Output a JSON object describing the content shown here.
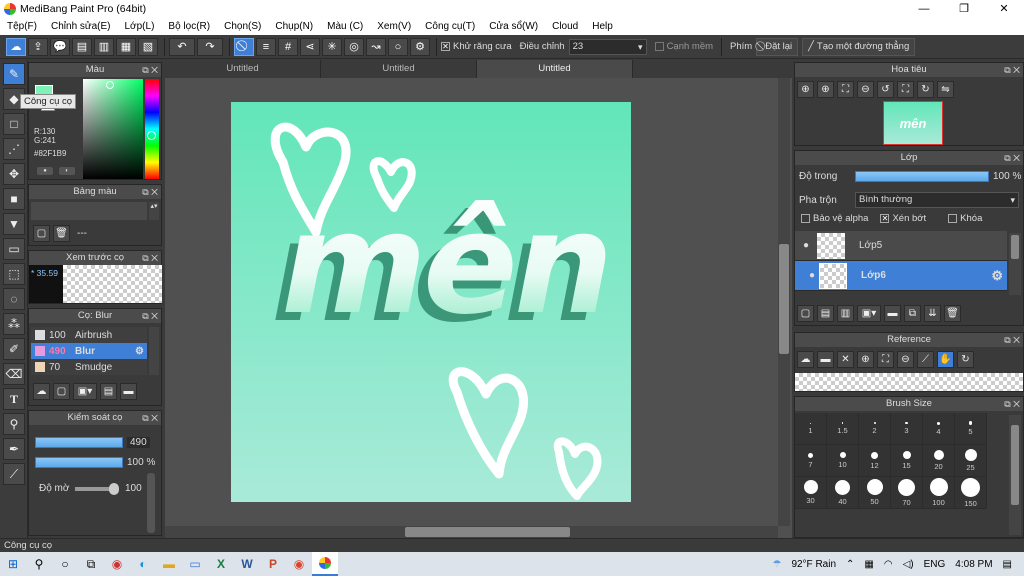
{
  "window": {
    "title": "MediBang Paint Pro (64bit)",
    "minimize": "—",
    "maximize": "❐",
    "close": "✕"
  },
  "menu": [
    "Tệp(F)",
    "Chỉnh sửa(E)",
    "Lớp(L)",
    "Bộ lọc(R)",
    "Chọn(S)",
    "Chụp(N)",
    "Màu (C)",
    "Xem(V)",
    "Công cụ(T)",
    "Cửa sổ(W)",
    "Cloud",
    "Help"
  ],
  "toolbar": {
    "antialias_label": "Khử răng cưa",
    "correction_label": "Điều chỉnh",
    "correction_value": "23",
    "soft_edge_label": "Cạnh mềm",
    "key_label": "Phím",
    "reset_label": "Đặt lại",
    "line_label": "Tạo một đường thẳng"
  },
  "tooltip": "Công cụ cọ",
  "color_panel": {
    "title": "Màu",
    "r": "R:130",
    "g": "G:241",
    "hex": "#82F1B9",
    "current_color": "#82F1B9"
  },
  "palette_panel": {
    "title": "Bảng màu",
    "item": "---"
  },
  "preview_panel": {
    "title": "Xem trước cọ",
    "size": "* 35.59"
  },
  "brush_panel": {
    "title": "Cọ: Blur",
    "items": [
      {
        "size": "100",
        "name": "Airbrush",
        "swatch": "#dddddd"
      },
      {
        "size": "490",
        "name": "Blur",
        "swatch": "#e79ae0"
      },
      {
        "size": "70",
        "name": "Smudge",
        "swatch": "#f0d4b8"
      }
    ]
  },
  "brush_control": {
    "title": "Kiểm soát cọ",
    "size_value": "490",
    "opacity_value": "100 %",
    "density_label": "Độ mờ",
    "density_value": "100"
  },
  "doc_tabs": [
    "Untitled",
    "Untitled",
    "Untitled"
  ],
  "artwork_text": "mên",
  "navigator": {
    "title": "Hoa tiêu"
  },
  "layer_panel": {
    "title": "Lớp",
    "opacity_label": "Độ trong",
    "opacity_value": "100 %",
    "blend_label": "Pha trộn",
    "blend_value": "Bình thường",
    "protect_alpha": "Bảo vệ alpha",
    "clipping": "Xén bớt",
    "lock": "Khóa",
    "layers": [
      {
        "name": "Lớp5",
        "selected": false
      },
      {
        "name": "Lớp6",
        "selected": true
      }
    ]
  },
  "reference_panel": {
    "title": "Reference"
  },
  "brush_size_panel": {
    "title": "Brush Size",
    "sizes": [
      "1",
      "1.5",
      "2",
      "3",
      "4",
      "5",
      "7",
      "10",
      "12",
      "15",
      "20",
      "25",
      "30",
      "40",
      "50",
      "70",
      "100",
      "150"
    ]
  },
  "status": "Công cụ cọ",
  "taskbar": {
    "weather": "92°F Rain",
    "lang": "ENG",
    "time": "4:08 PM"
  }
}
